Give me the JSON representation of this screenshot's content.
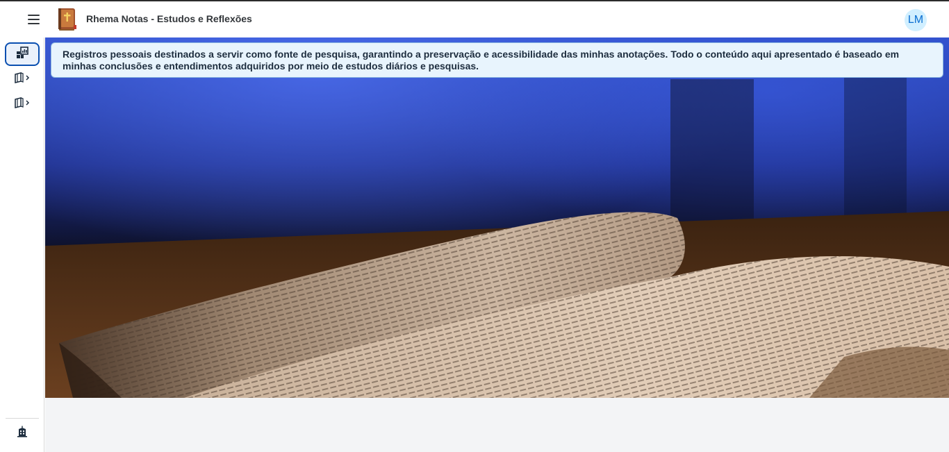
{
  "header": {
    "title": "Rhema Notas - Estudos e Reflexões",
    "avatar_initials": "LM"
  },
  "sidebar": {
    "items": [
      {
        "icon": "dashboard-icon",
        "active": true
      },
      {
        "icon": "book-chevron-icon",
        "active": false
      },
      {
        "icon": "book-chevron-icon",
        "active": false
      }
    ],
    "footer_icon": "building-icon"
  },
  "main": {
    "info_text": "Registros pessoais destinados a servir como fonte de pesquisa, garantindo a preservação e acessibilidade das minhas anotações. Todo o conteúdo aqui apresentado é baseado em minhas conclusões e entendimentos adquiridos por meio de estudos diários e pesquisas."
  },
  "colors": {
    "accent": "#0a4fb0",
    "avatar_bg": "#d1efff",
    "info_bg": "#e8f4fd"
  }
}
